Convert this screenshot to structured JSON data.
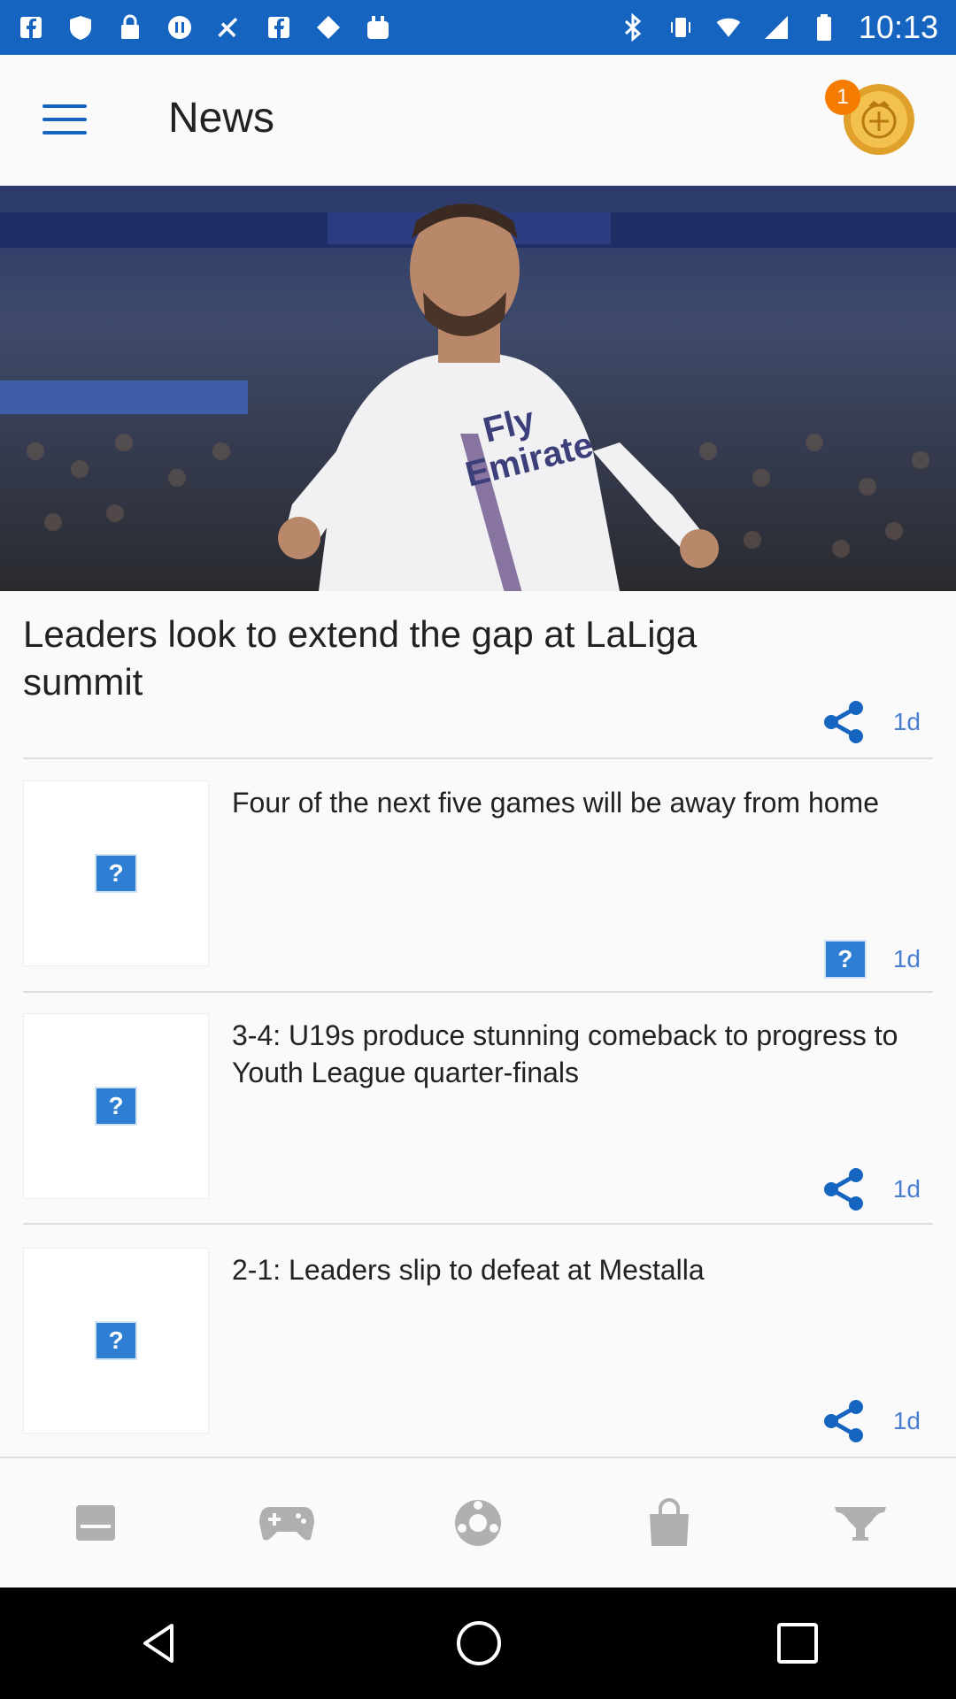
{
  "status_bar": {
    "time": "10:13",
    "icons": [
      "facebook-icon",
      "shield-icon",
      "lock-icon",
      "pause-circle-icon",
      "fake-gps-icon",
      "facebook-icon",
      "map-pin-icon",
      "bag-icon",
      "bluetooth-icon",
      "vibrate-icon",
      "wifi-icon",
      "signal-icon",
      "battery-icon"
    ]
  },
  "app_bar": {
    "title": "News",
    "notification_count": "1"
  },
  "lead_story": {
    "title": "Leaders look to extend the gap at LaLiga summit",
    "age": "1d"
  },
  "news_items": [
    {
      "title": "Four of the next five games will be away from home",
      "age": "1d",
      "action_icon": "broken-image-icon"
    },
    {
      "title": "3-4: U19s produce stunning comeback to progress to Youth League quarter-finals",
      "age": "1d",
      "action_icon": "share-icon"
    },
    {
      "title": "2-1: Leaders slip to defeat at Mestalla",
      "age": "1d",
      "action_icon": "share-icon"
    }
  ],
  "bottom_nav": [
    "news-tab-icon",
    "games-tab-icon",
    "matches-tab-icon",
    "shop-tab-icon",
    "trophies-tab-icon"
  ],
  "colors": {
    "accent": "#1565c0",
    "badge": "#f57c00",
    "meta": "#4a7fcf"
  }
}
